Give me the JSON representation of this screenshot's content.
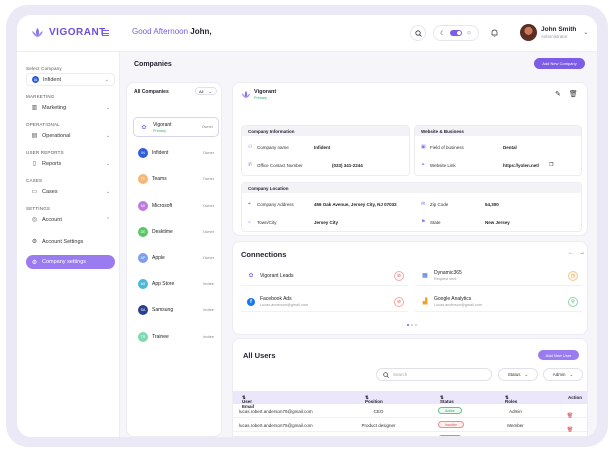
{
  "app": {
    "brand": "VIGORANT",
    "greeting_prefix": "Good Afternoon",
    "greeting_name": "John,"
  },
  "user": {
    "name": "John Smith",
    "role": "Administrator"
  },
  "colors": {
    "accent": "#7d5ce6",
    "accent_light": "#9b7cf0",
    "success": "#2fb46e",
    "danger": "#e05454"
  },
  "sidebar": {
    "select_company_label": "Select Company",
    "selected_company": {
      "initials": "IA",
      "name": "Infident"
    },
    "sections": [
      {
        "label": "MARKETING",
        "item": "Marketing"
      },
      {
        "label": "OPERATIONAL",
        "item": "Operational"
      },
      {
        "label": "USER REPORTS",
        "item": "Reports"
      },
      {
        "label": "CASES",
        "item": "Cases"
      },
      {
        "label": "SETTINGS",
        "item": "Account"
      }
    ],
    "sub_items": [
      "Account Settings",
      "Company settings"
    ]
  },
  "companies": {
    "title": "Companies",
    "add_button": "Add New Company",
    "list_title": "All Companies",
    "filter": "All",
    "items": [
      {
        "initials": "",
        "name": "Vigorant",
        "sub": "Primary",
        "role": "Owner",
        "color": "#8a6fe8"
      },
      {
        "initials": "IN",
        "name": "Infident",
        "sub": "",
        "role": "Owner",
        "color": "#2f5fd8"
      },
      {
        "initials": "TE",
        "name": "Teams",
        "sub": "",
        "role": "Owner",
        "color": "#f4b778"
      },
      {
        "initials": "MI",
        "name": "Microsoft",
        "sub": "",
        "role": "Owner",
        "color": "#c07be0"
      },
      {
        "initials": "DE",
        "name": "Desktime",
        "sub": "",
        "role": "Owner",
        "color": "#5ac86a"
      },
      {
        "initials": "AP",
        "name": "Apple",
        "sub": "",
        "role": "Owner",
        "color": "#7d9df0"
      },
      {
        "initials": "AS",
        "name": "App Store",
        "sub": "",
        "role": "Invitee",
        "color": "#4ab8d8"
      },
      {
        "initials": "SA",
        "name": "Samsung",
        "sub": "",
        "role": "Invitee",
        "color": "#2a3f8f"
      },
      {
        "initials": "TR",
        "name": "Trainee",
        "sub": "",
        "role": "Invitee",
        "color": "#7fd8b0"
      }
    ]
  },
  "detail": {
    "name": "Vigorant",
    "sub": "Primary",
    "company_info": {
      "title": "Company Information",
      "name_label": "Company name",
      "name_value": "Infident",
      "phone_label": "Office Contact Number",
      "phone_value": "(033) 341-2244"
    },
    "website_info": {
      "title": "Website & Business",
      "field_label": "Field of business",
      "field_value": "Dental",
      "link_label": "Website Link",
      "link_value": "https://yolen.net/"
    },
    "location": {
      "title": "Company Location",
      "address_label": "Company Address",
      "address_value": "456 Oak Avenue, Jersey City, NJ 07032",
      "zip_label": "Zip Code",
      "zip_value": "54,300",
      "town_label": "Town/City",
      "town_value": "Jersey City",
      "state_label": "State",
      "state_value": "New Jersey"
    }
  },
  "connections": {
    "title": "Connections",
    "items": [
      {
        "name": "Vigorant Leads",
        "sub": "",
        "icon": "vigorant-icon"
      },
      {
        "name": "Dynamic365",
        "sub": "Request sent",
        "icon": "dynamics-icon"
      },
      {
        "name": "Facebook Ads",
        "sub": "Lucas.anderson@gmail.com",
        "icon": "facebook-icon"
      },
      {
        "name": "Google Analytics",
        "sub": "Lucas.anderson@gmail.com",
        "icon": "analytics-icon"
      }
    ]
  },
  "users": {
    "title": "All Users",
    "add_button": "Add New User",
    "search_placeholder": "Search",
    "status_filter": "Status",
    "role_filter": "Admin",
    "columns": [
      "User Email",
      "Position",
      "Status",
      "Roles",
      "Action"
    ],
    "rows": [
      {
        "email": "lucas.robert.anderson75@gmail.com",
        "position": "CEO",
        "status": "Active",
        "role": "Admin"
      },
      {
        "email": "lucas.robert.anderson75@gmail.com",
        "position": "Product designer",
        "status": "Inactive",
        "role": "Member"
      },
      {
        "email": "lucas.robert.anderson75@gmail.com",
        "position": "CEO",
        "status": "Active",
        "role": "Member"
      }
    ]
  }
}
